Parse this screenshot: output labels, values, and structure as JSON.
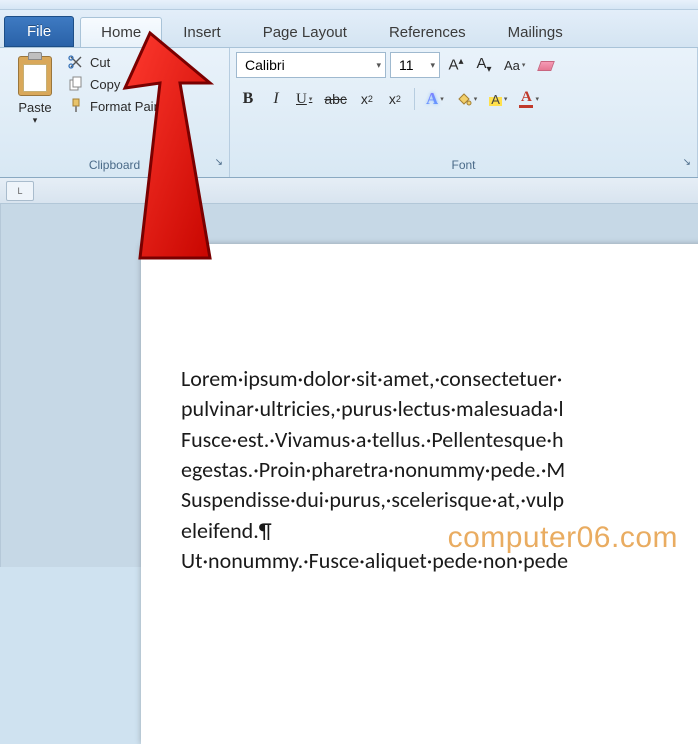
{
  "tabs": {
    "file": "File",
    "home": "Home",
    "insert": "Insert",
    "page_layout": "Page Layout",
    "references": "References",
    "mailings": "Mailings"
  },
  "clipboard": {
    "paste": "Paste",
    "cut": "Cut",
    "copy": "Copy",
    "format_painter": "Format Painter",
    "group_label": "Clipboard"
  },
  "font": {
    "name": "Calibri",
    "size": "11",
    "grow_glyph": "A",
    "shrink_glyph": "A",
    "case_label": "Aa",
    "bold": "B",
    "italic": "I",
    "underline": "U",
    "strike": "abc",
    "sub_x": "x",
    "sub_2": "2",
    "sup_x": "x",
    "sup_2": "2",
    "text_effects": "A",
    "highlight": "A",
    "font_color": "A",
    "group_label": "Font"
  },
  "navbox_label": "L",
  "document": {
    "lines": [
      "Lorem·ipsum·dolor·sit·amet,·consectetuer·",
      "pulvinar·ultricies,·purus·lectus·malesuada·l",
      "Fusce·est.·Vivamus·a·tellus.·Pellentesque·h",
      "egestas.·Proin·pharetra·nonummy·pede.·M",
      "Suspendisse·dui·purus,·scelerisque·at,·vulp",
      "eleifend.¶",
      "Ut·nonummy.·Fusce·aliquet·pede·non·pede"
    ]
  },
  "watermark": "computer06.com"
}
